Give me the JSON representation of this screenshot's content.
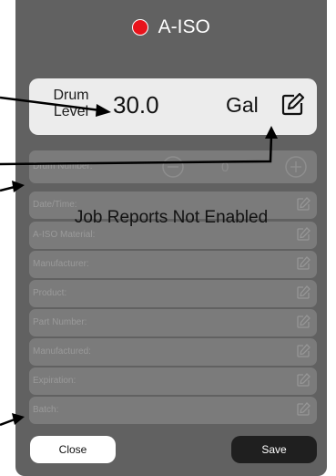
{
  "header": {
    "title": "A-ISO",
    "status_color": "#e8131b"
  },
  "drum_level": {
    "label": "Drum Level",
    "value": "30.0",
    "unit": "Gal",
    "icon": "edit-icon"
  },
  "drum_number": {
    "label": "Drum Number:",
    "value": "0",
    "icons": [
      "minus-circle-icon",
      "plus-circle-icon"
    ]
  },
  "fields": [
    {
      "label": "Date/Time:"
    },
    {
      "label": "A-ISO Material:"
    },
    {
      "label": "Manufacturer:"
    },
    {
      "label": "Product:"
    },
    {
      "label": "Part Number:"
    },
    {
      "label": "Manufactured:"
    },
    {
      "label": "Expiration:"
    },
    {
      "label": "Batch:"
    }
  ],
  "message": "Job Reports Not Enabled",
  "buttons": {
    "close": "Close",
    "save": "Save"
  }
}
